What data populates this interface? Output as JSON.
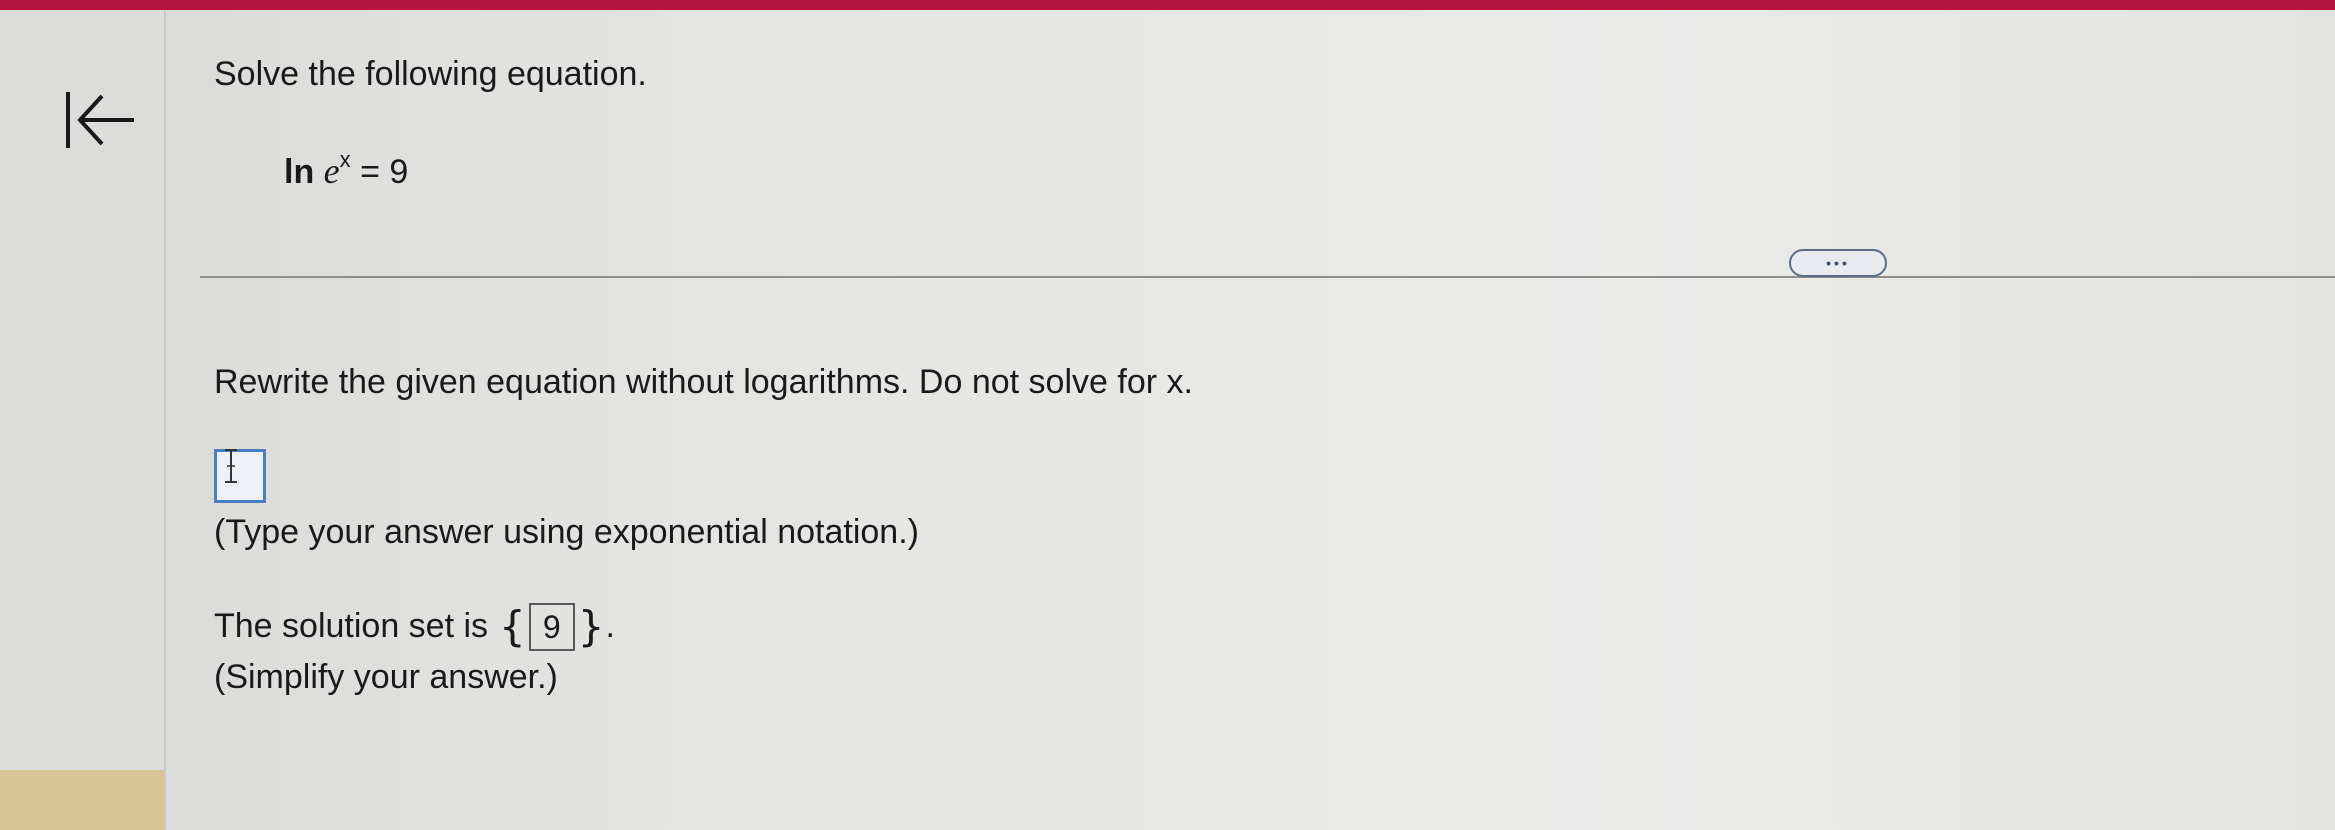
{
  "problem": {
    "title": "Solve the following equation.",
    "equation": {
      "ln": "ln",
      "base": "e",
      "exponent": "x",
      "rhs": "= 9"
    }
  },
  "more_button": {
    "label": "•••"
  },
  "step": {
    "instruction": "Rewrite the given equation without logarithms. Do not solve for x.",
    "answer_value": "",
    "hint": "(Type your answer using exponential notation.)"
  },
  "solution": {
    "prefix": "The solution set is",
    "open_brace": "{",
    "value": "9",
    "close_brace": "}",
    "suffix": ".",
    "hint": "(Simplify your answer.)"
  },
  "colors": {
    "top_bar": "#b5163f",
    "input_border": "#4a7fc1",
    "more_button_border": "#5a6f86"
  },
  "icons": {
    "back": "arrow-left-to-bar-icon",
    "cursor": "text-cursor-icon"
  }
}
